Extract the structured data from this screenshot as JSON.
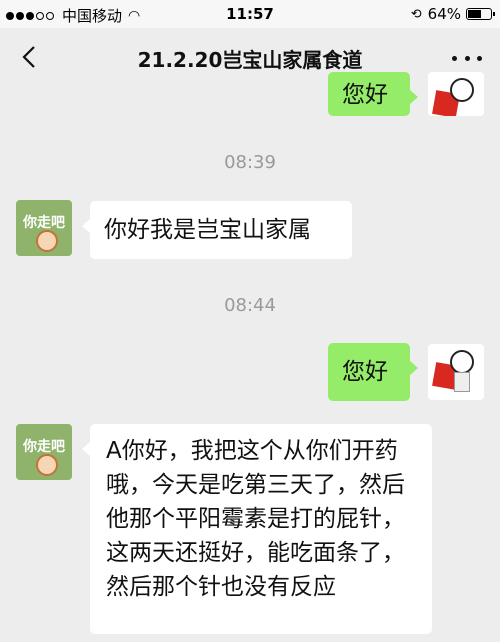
{
  "status_bar": {
    "carrier": "中国移动",
    "time": "11:57",
    "battery": "64%",
    "battery_level": 0.64,
    "signal_bars": 3,
    "signal_total": 5
  },
  "nav": {
    "title": "21.2.20岂宝山家属食道",
    "back_icon": "chevron-left-icon",
    "more_icon": "more-dots-icon"
  },
  "avatars": {
    "other_text": "你走吧"
  },
  "messages": [
    {
      "type": "message",
      "side": "right",
      "text": "您好"
    },
    {
      "type": "time",
      "text": "08:39"
    },
    {
      "type": "message",
      "side": "left",
      "text": "你好我是岂宝山家属"
    },
    {
      "type": "time",
      "text": "08:44"
    },
    {
      "type": "message",
      "side": "right",
      "text": "您好"
    },
    {
      "type": "message",
      "side": "left",
      "text": "A你好，我把这个从你们开药哦，今天是吃第三天了，然后他那个平阳霉素是打的屁针，这两天还挺好，能吃面条了，然后那个针也没有反应"
    }
  ],
  "colors": {
    "background": "#ededed",
    "bubble_self": "#95ec69",
    "bubble_other": "#ffffff",
    "timestamp": "#9a9a9a"
  }
}
